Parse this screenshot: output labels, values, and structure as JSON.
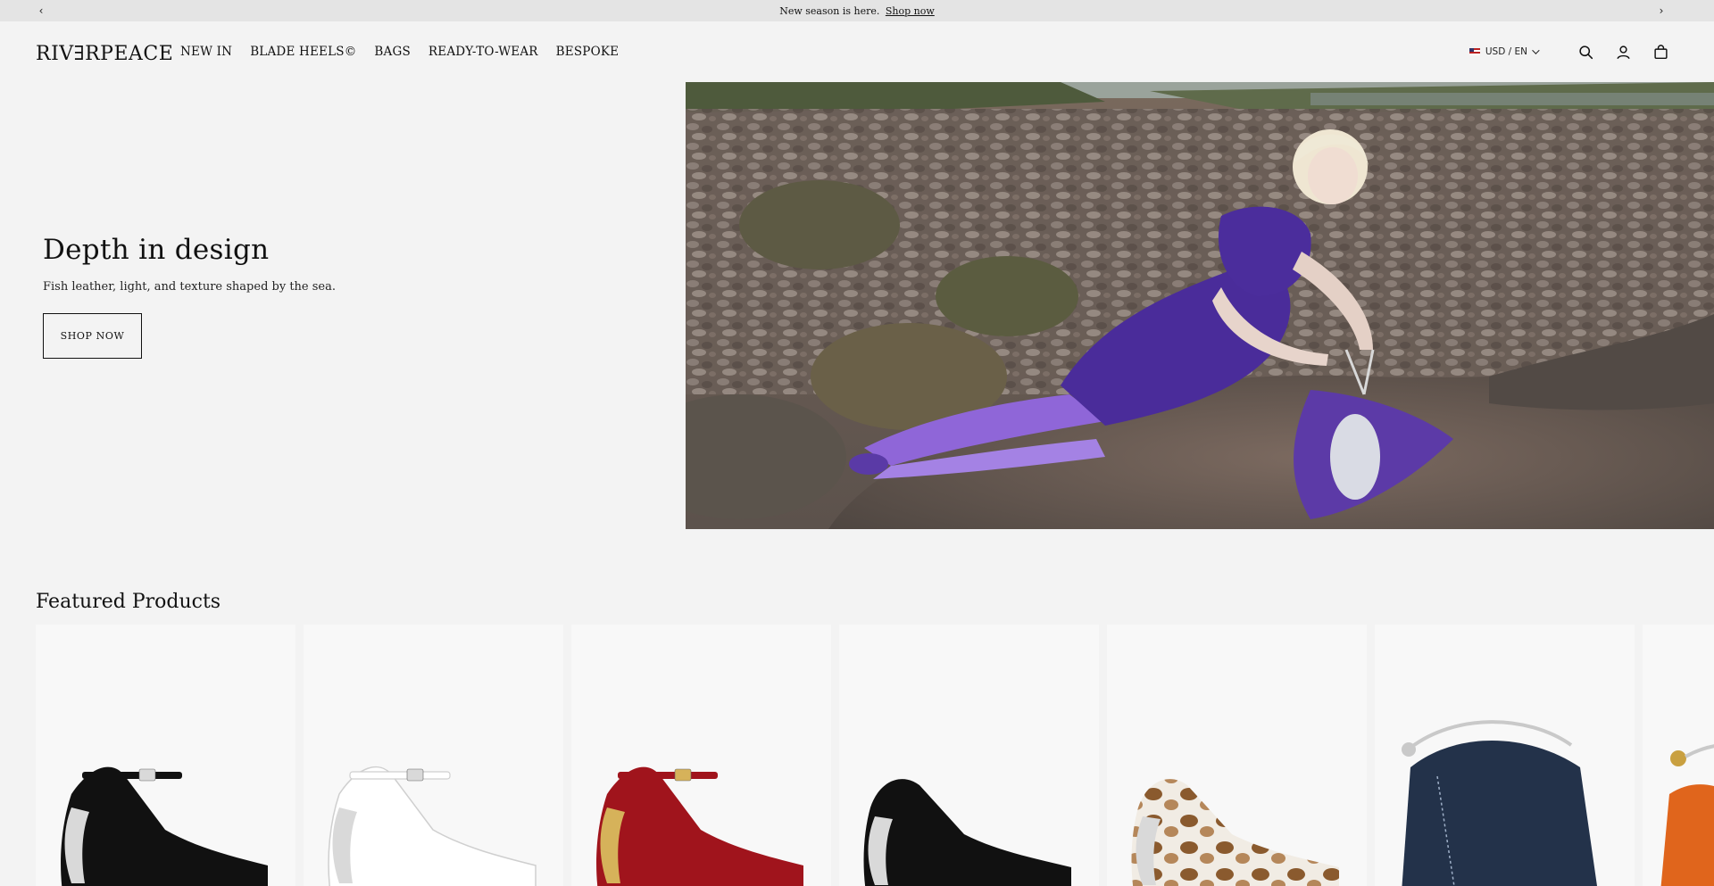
{
  "announcement": {
    "message": "New season is here.",
    "link": "Shop now",
    "prev_icon": "chevron-left-icon",
    "next_icon": "chevron-right-icon"
  },
  "header": {
    "logo": "RIV∃RPEACE",
    "nav": [
      "NEW IN",
      "BLADE HEELS©",
      "BAGS",
      "READY-TO-WEAR",
      "BESPOKE"
    ],
    "currency": "USD / EN",
    "icons": [
      "search-icon",
      "account-icon",
      "bag-icon"
    ]
  },
  "hero": {
    "title": "Depth in design",
    "subtitle": "Fish leather, light, and texture shaped by the sea.",
    "cta": "SHOP NOW"
  },
  "featured": {
    "title": "Featured Products",
    "products": [
      {
        "color": "#111111",
        "accent": "#d9d9d9",
        "kind": "strap-heel"
      },
      {
        "color": "#ffffff",
        "accent": "#d9d9d9",
        "kind": "strap-heel"
      },
      {
        "color": "#a0141c",
        "accent": "#d6b25a",
        "kind": "strap-heel"
      },
      {
        "color": "#111111",
        "accent": "#d9d9d9",
        "kind": "pump"
      },
      {
        "color": "#c7a57a",
        "accent": "#d9d9d9",
        "kind": "pump-pattern"
      },
      {
        "color": "#23324a",
        "accent": "#c9c9c9",
        "kind": "bag"
      },
      {
        "color": "#e0651c",
        "accent": "#c9a040",
        "kind": "bag-partial"
      }
    ]
  },
  "colors": {
    "background": "#f3f3f3",
    "announcement_bg": "#e4e4e4",
    "text": "#111111"
  }
}
